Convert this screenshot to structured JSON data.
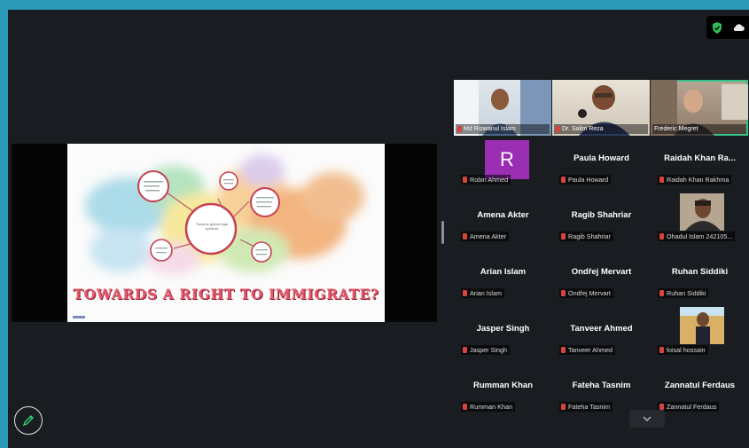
{
  "slide": {
    "title": "TOWARDS A RIGHT TO IMMIGRATE?",
    "center_node_text": "Towards global legal symbols"
  },
  "video_tiles": [
    {
      "name": "Md Rizwanul Islam",
      "active": false
    },
    {
      "name": "Dr. Salim Reza",
      "active": false
    },
    {
      "name": "Frederic Megret",
      "active": true
    }
  ],
  "participants": [
    [
      {
        "display": "",
        "tag": "Robin Ahmed",
        "avatar_letter": "R",
        "avatar_color": "#9a2fb4"
      },
      {
        "display": "Paula Howard",
        "tag": "Paula Howard"
      },
      {
        "display": "Raidah Khan Ra...",
        "tag": "Raidah Khan Rakhma"
      }
    ],
    [
      {
        "display": "Amena Akter",
        "tag": "Amena Akter"
      },
      {
        "display": "Ragib Shahriar",
        "tag": "Ragib Shahriar"
      },
      {
        "display": "",
        "tag": "Ohadul Islam 242105..."
      }
    ],
    [
      {
        "display": "Arian Islam",
        "tag": "Arian Islam"
      },
      {
        "display": "Ondřej Mervart",
        "tag": "Ondřej Mervart"
      },
      {
        "display": "Ruhan Siddiki",
        "tag": "Ruhan Siddiki"
      }
    ],
    [
      {
        "display": "Jasper Singh",
        "tag": "Jasper Singh"
      },
      {
        "display": "Tanveer Ahmed",
        "tag": "Tanveer Ahmed"
      },
      {
        "display": "",
        "tag": "foisal hossain"
      }
    ],
    [
      {
        "display": "Rumman Khan",
        "tag": "Rumman Khan"
      },
      {
        "display": "Fateha Tasnim",
        "tag": "Fateha Tasnim"
      },
      {
        "display": "Zannatul Ferdaus",
        "tag": "Zannatul Ferdaus"
      }
    ]
  ],
  "icons": {
    "security": "shield-check-icon",
    "cloud": "cloud-icon",
    "more": "chevron-down-icon",
    "annotate": "pen-icon"
  },
  "colors": {
    "frame": "#2a9ab8",
    "app_bg": "#191c20",
    "active_speaker": "#34c28a",
    "muted": "#d9433d",
    "avatar_r": "#9a2fb4",
    "slide_title": "#e8566a"
  }
}
